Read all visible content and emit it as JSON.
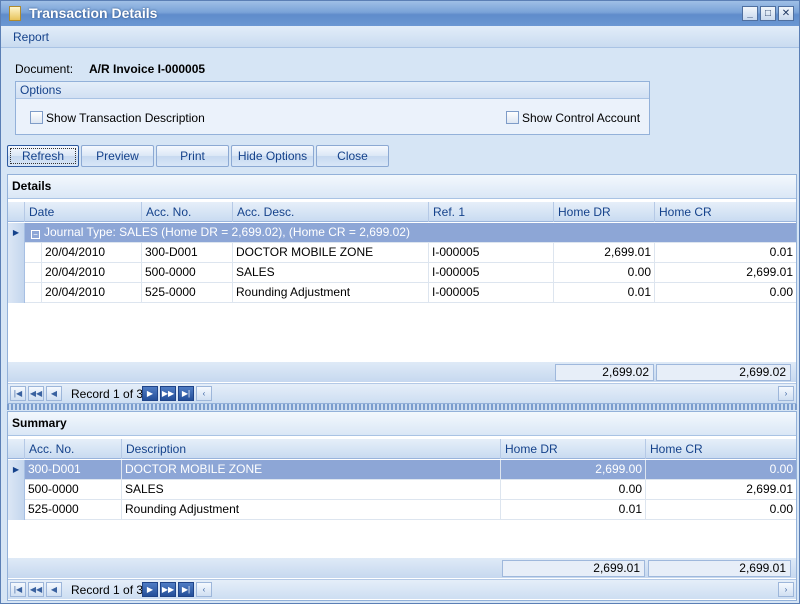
{
  "window": {
    "title": "Transaction Details"
  },
  "menu": {
    "report": "Report"
  },
  "document": {
    "label": "Document:",
    "value": "A/R Invoice I-000005"
  },
  "options": {
    "title": "Options",
    "show_description": "Show Transaction Description",
    "show_control": "Show Control Account"
  },
  "buttons": {
    "refresh": "Refresh",
    "preview": "Preview",
    "print": "Print",
    "hide_options": "Hide Options",
    "close": "Close"
  },
  "details": {
    "title": "Details",
    "columns": [
      "Date",
      "Acc. No.",
      "Acc. Desc.",
      "Ref. 1",
      "Home DR",
      "Home CR"
    ],
    "group": "Journal Type: SALES (Home DR = 2,699.02), (Home CR = 2,699.02)",
    "rows": [
      [
        "20/04/2010",
        "300-D001",
        "DOCTOR MOBILE ZONE",
        "I-000005",
        "2,699.01",
        "0.01"
      ],
      [
        "20/04/2010",
        "500-0000",
        "SALES",
        "I-000005",
        "0.00",
        "2,699.01"
      ],
      [
        "20/04/2010",
        "525-0000",
        "Rounding Adjustment",
        "I-000005",
        "0.01",
        "0.00"
      ]
    ],
    "total_dr": "2,699.02",
    "total_cr": "2,699.02",
    "record_text": "Record 1 of 3"
  },
  "summary": {
    "title": "Summary",
    "columns": [
      "Acc. No.",
      "Description",
      "Home DR",
      "Home CR"
    ],
    "rows": [
      [
        "300-D001",
        "DOCTOR MOBILE ZONE",
        "2,699.00",
        "0.00"
      ],
      [
        "500-0000",
        "SALES",
        "0.00",
        "2,699.01"
      ],
      [
        "525-0000",
        "Rounding Adjustment",
        "0.01",
        "0.00"
      ]
    ],
    "total_dr": "2,699.01",
    "total_cr": "2,699.01",
    "record_text": "Record 1 of 3"
  }
}
